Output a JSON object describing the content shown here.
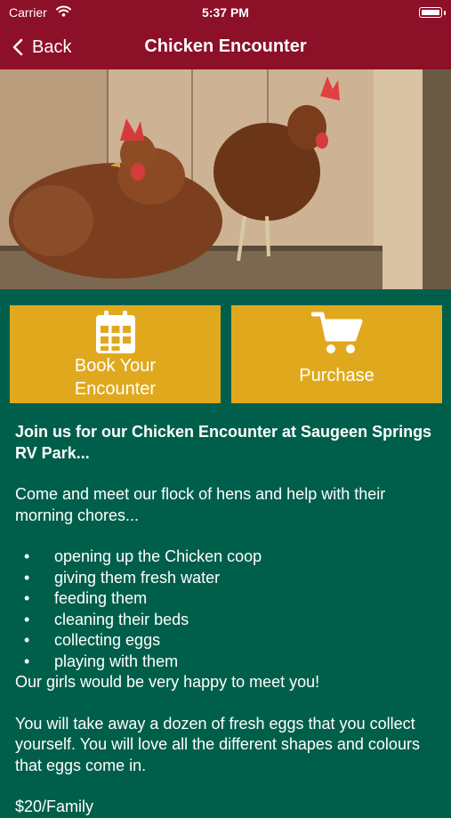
{
  "status_bar": {
    "carrier": "Carrier",
    "time": "5:37 PM"
  },
  "nav": {
    "back_label": "Back",
    "title": "Chicken Encounter"
  },
  "carousel": {
    "page_count": 2,
    "current_page": 1
  },
  "buttons": {
    "book": {
      "label_line1": "Book Your",
      "label_line2": "Encounter",
      "icon": "calendar-icon"
    },
    "purchase": {
      "label": "Purchase",
      "icon": "cart-icon"
    }
  },
  "content": {
    "intro": "Join us for our Chicken Encounter at Saugeen Springs RV Park...",
    "lead": "Come and meet our flock of hens and help with their morning chores...",
    "tasks": [
      "opening up the Chicken coop",
      "giving them fresh water",
      "feeding them",
      "cleaning their beds",
      "collecting eggs",
      "playing with them"
    ],
    "closing": "Our girls would be very happy to meet you!",
    "eggs": "You will take away a dozen of fresh eggs that you collect yourself. You will love all the different shapes and colours that eggs come in.",
    "price": "$20/Family"
  },
  "colors": {
    "header": "#8c1028",
    "background": "#005f4b",
    "button": "#e0a91d"
  }
}
